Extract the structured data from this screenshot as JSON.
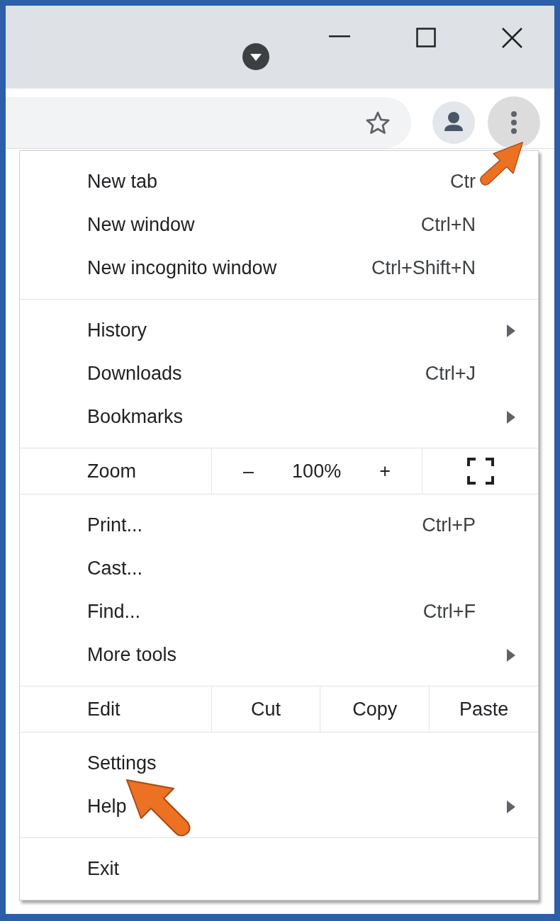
{
  "menu": {
    "sections": [
      {
        "kind": "items",
        "items": [
          {
            "label": "New tab",
            "shortcut": "Ctr",
            "submenu": false
          },
          {
            "label": "New window",
            "shortcut": "Ctrl+N",
            "submenu": false
          },
          {
            "label": "New incognito window",
            "shortcut": "Ctrl+Shift+N",
            "submenu": false
          }
        ]
      },
      {
        "kind": "items",
        "items": [
          {
            "label": "History",
            "submenu": true
          },
          {
            "label": "Downloads",
            "shortcut": "Ctrl+J",
            "submenu": false
          },
          {
            "label": "Bookmarks",
            "submenu": true
          }
        ]
      },
      {
        "kind": "zoom",
        "label": "Zoom",
        "minus": "–",
        "value": "100%",
        "plus": "+"
      },
      {
        "kind": "items",
        "items": [
          {
            "label": "Print...",
            "shortcut": "Ctrl+P",
            "submenu": false
          },
          {
            "label": "Cast...",
            "submenu": false
          },
          {
            "label": "Find...",
            "shortcut": "Ctrl+F",
            "submenu": false
          },
          {
            "label": "More tools",
            "submenu": true
          }
        ]
      },
      {
        "kind": "edit",
        "label": "Edit",
        "buttons": [
          "Cut",
          "Copy",
          "Paste"
        ]
      },
      {
        "kind": "items",
        "items": [
          {
            "label": "Settings",
            "submenu": false
          },
          {
            "label": "Help",
            "submenu": true
          }
        ]
      },
      {
        "kind": "items",
        "items": [
          {
            "label": "Exit",
            "submenu": false
          }
        ]
      }
    ]
  }
}
